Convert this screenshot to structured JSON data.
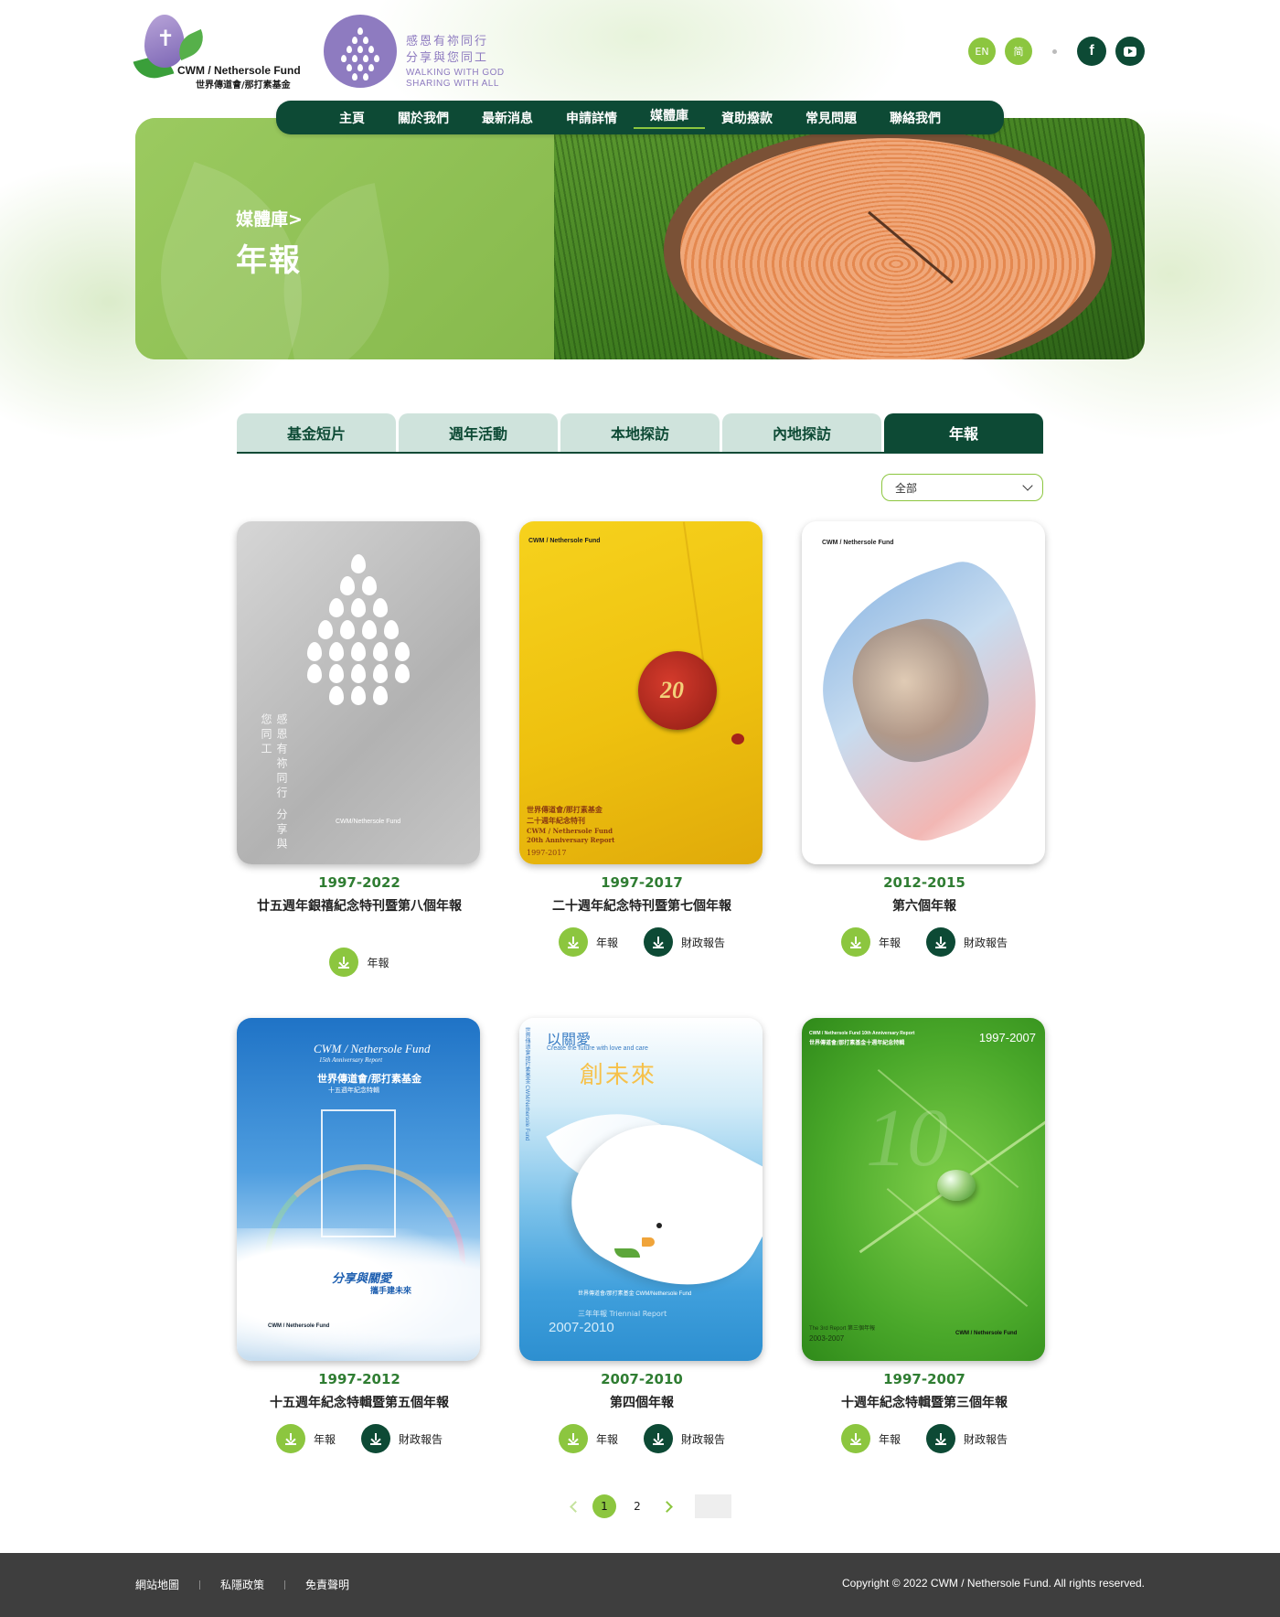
{
  "header": {
    "logo_text_en": "CWM / Nethersole Fund",
    "logo_text_zh": "世界傳道會/那打素基金",
    "motto_zh_1": "感恩有祢同行",
    "motto_zh_2": "分享與您同工",
    "motto_en_1": "WALKING WITH GOD",
    "motto_en_2": "SHARING WITH ALL",
    "lang_en": "EN",
    "lang_sc": "简",
    "facebook_icon": "f"
  },
  "nav": {
    "items": [
      "主頁",
      "關於我們",
      "最新消息",
      "申請詳情",
      "媒體庫",
      "資助撥款",
      "常見問題",
      "聯絡我們"
    ],
    "active": "媒體庫"
  },
  "hero": {
    "breadcrumb": "媒體庫>",
    "title": "年報"
  },
  "tabs": {
    "items": [
      "基金短片",
      "週年活動",
      "本地探訪",
      "內地探訪",
      "年報"
    ],
    "active": "年報"
  },
  "filter": {
    "selected": "全部"
  },
  "reports": [
    {
      "years": "1997-2022",
      "title": "廿五週年銀禧紀念特刊暨第八個年報",
      "buttons": [
        "年報"
      ]
    },
    {
      "years": "1997-2017",
      "title": "二十週年紀念特刊暨第七個年報",
      "buttons": [
        "年報",
        "財政報告"
      ]
    },
    {
      "years": "2012-2015",
      "title": "第六個年報",
      "buttons": [
        "年報",
        "財政報告"
      ]
    },
    {
      "years": "1997-2012",
      "title": "十五週年紀念特輯暨第五個年報",
      "buttons": [
        "年報",
        "財政報告"
      ]
    },
    {
      "years": "2007-2010",
      "title": "第四個年報",
      "buttons": [
        "年報",
        "財政報告"
      ]
    },
    {
      "years": "1997-2007",
      "title": "十週年紀念特輯暨第三個年報",
      "buttons": [
        "年報",
        "財政報告"
      ]
    }
  ],
  "covers": {
    "c1_vertical": "感恩有祢同行 分享與您同工",
    "c1_mini": "CWM/Nethersole Fund",
    "c2_seal": "20",
    "c2_line1": "世界傳道會/那打素基金",
    "c2_line2": "二十週年紀念特刊",
    "c2_line3": "CWM / Nethersole Fund",
    "c2_line4": "20th Anniversary Report",
    "c2_line5": "1997-2017",
    "c2_logo": "CWM / Nethersole Fund",
    "c3_logo": "CWM / Nethersole Fund",
    "c4_line1": "CWM / Nethersole Fund",
    "c4_line2": "15th Anniversary Report",
    "c4_line3": "世界傳道會/那打素基金",
    "c4_line4": "十五週年紀念特輯",
    "c4_line5": "分享與關愛",
    "c4_line6": "攜手建未來",
    "c4_logo": "CWM / Nethersole Fund",
    "c5_line1": "以關愛",
    "c5_line2": "Create the future with love and care",
    "c5_line3": "創未來",
    "c5_line4": "世界傳道會/那打素基金 CWM/Nethersole Fund",
    "c5_line5": "三年年報 Triennial Report",
    "c5_line6": "2007-2010",
    "c5_vertical": "世界傳道會/那打素基金 CWM/Nethersole Fund",
    "c6_line1": "CWM / Nethersole Fund 10th Anniversary Report",
    "c6_line2": "世界傳道會/那打素基金十週年紀念特輯",
    "c6_line3": "1997-2007",
    "c6_big": "10",
    "c6_line4": "The 3rd Report 第三個年報",
    "c6_line5": "2003-2007",
    "c6_logo": "CWM / Nethersole Fund"
  },
  "pagination": {
    "pages": [
      "1",
      "2"
    ],
    "current": "1"
  },
  "footer": {
    "links": [
      "網站地圖",
      "私隱政策",
      "免責聲明"
    ],
    "copyright": "Copyright © 2022 CWM / Nethersole Fund. All rights reserved."
  },
  "colors": {
    "primary_dark": "#0d4a35",
    "accent_green": "#8cc63f",
    "year_green": "#2f7d32",
    "footer_bg": "#3e3e3e"
  }
}
